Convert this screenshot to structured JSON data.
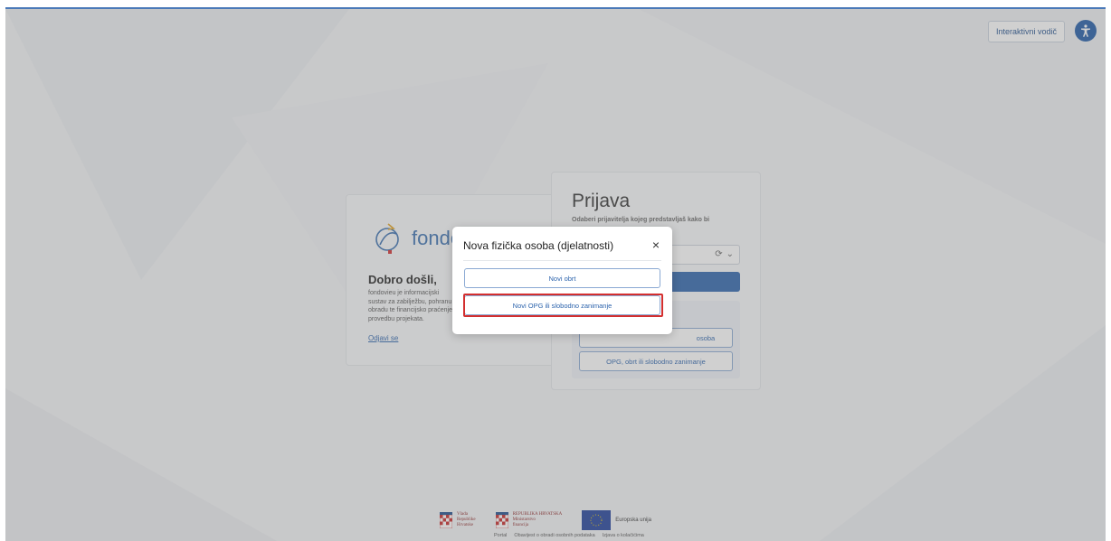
{
  "header": {
    "guide_label": "Interaktivni vodič"
  },
  "welcome": {
    "logo_text": "fondo",
    "title": "Dobro došli,",
    "description": "fondovieu je informacijski sustav za zabilježbu, pohranu i obradu te financijsko praćenje i provedbu projekata.",
    "logout_link": "Odjavi se"
  },
  "login": {
    "title": "Prijava",
    "subtitle": "Odaberi prijavitelja kojeg predstavljaš kako bi",
    "panel_button_1": "osoba",
    "panel_button_2": "OPG, obrt ili slobodno zanimanje"
  },
  "modal": {
    "title": "Nova fizička osoba (djelatnosti)",
    "close_icon": "×",
    "option_1": "Novi obrt",
    "option_2": "Novi OPG ili slobodno zanimanje"
  },
  "footer": {
    "vlada": "Vlada\nRepublike\nHrvatske",
    "ministarstvo": "REPUBLIKA HRVATSKA\nMinistarstvo\nfinancija",
    "eu": "Europska unija",
    "links": [
      "Portal",
      "Obavijest o obradi osobnih podataka",
      "Izjava o kolačićima"
    ]
  },
  "colors": {
    "accent": "#2d64ad",
    "highlight": "#d32f2f"
  }
}
